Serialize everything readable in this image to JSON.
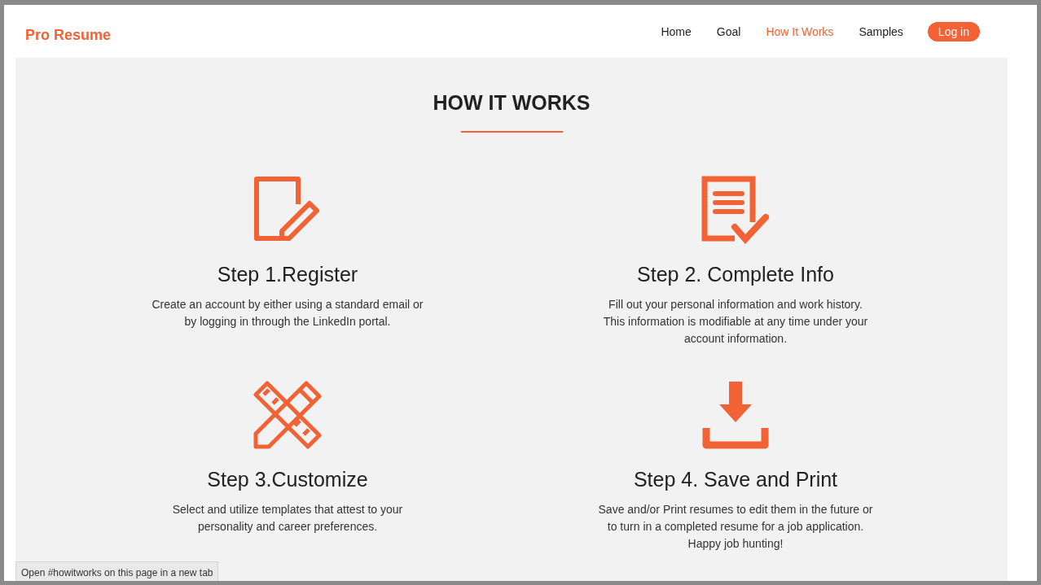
{
  "brand": "Pro Resume",
  "nav": [
    {
      "label": "Home",
      "selected": false
    },
    {
      "label": "Goal",
      "selected": false
    },
    {
      "label": "How It Works",
      "selected": true
    },
    {
      "label": "Samples",
      "selected": false
    }
  ],
  "login_button": "Log in",
  "section_title": "HOW IT WORKS",
  "steps": [
    {
      "kind": "register",
      "title": "Step 1.Register",
      "description": "Create an account by either using a standard email or by logging in through the LinkedIn portal."
    },
    {
      "kind": "info",
      "title": "Step 2. Complete Info",
      "description": "Fill out your personal information and work history. This information is modifiable at any time under your account information."
    },
    {
      "kind": "customize",
      "title": "Step 3.Customize",
      "description": "Select and utilize templates that attest to your personality and career preferences."
    },
    {
      "kind": "save",
      "title": "Step 4. Save and Print",
      "description": "Save and/or Print resumes to edit them in the future or to turn in a completed resume for a job application. Happy job hunting!"
    }
  ],
  "status_bar": "Open #howitworks on this page in a new tab"
}
